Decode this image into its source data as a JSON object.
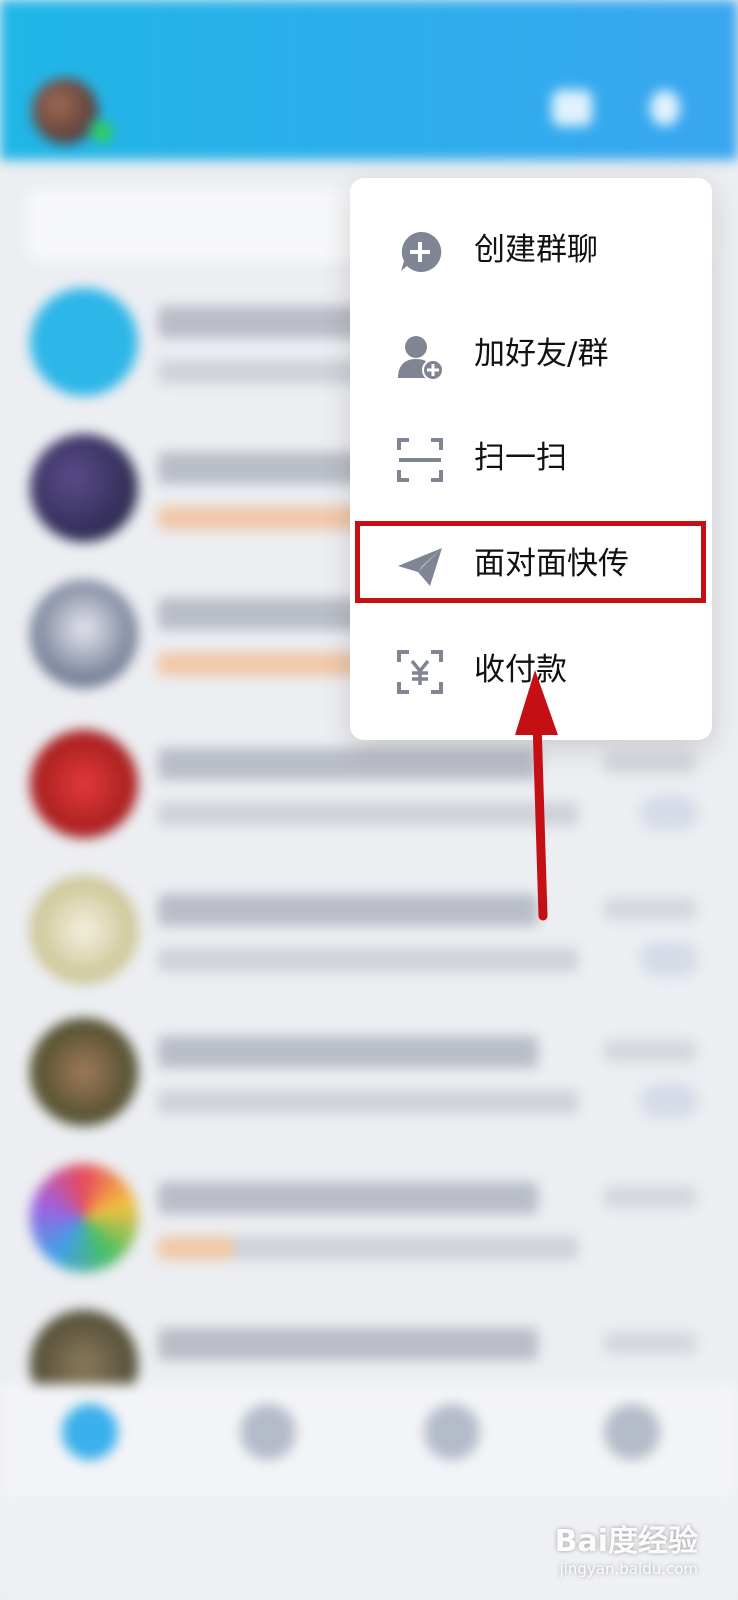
{
  "menu": {
    "items": [
      {
        "label": "创建群聊",
        "icon": "create-group-chat-icon"
      },
      {
        "label": "加好友/群",
        "icon": "add-friend-icon"
      },
      {
        "label": "扫一扫",
        "icon": "scan-icon"
      },
      {
        "label": "面对面快传",
        "icon": "paper-plane-icon"
      },
      {
        "label": "收付款",
        "icon": "payment-qr-icon"
      }
    ],
    "highlighted_item": "面对面快传"
  },
  "annotation": {
    "color": "#c40f14",
    "arrow_target": "收付款"
  },
  "colors": {
    "header_gradient_start": "#1fb6e6",
    "header_gradient_end": "#3aa6f0",
    "icon_gray": "#7f8592"
  },
  "watermark": {
    "brand": "Bai度经验",
    "url": "jingyan.baidu.com"
  }
}
